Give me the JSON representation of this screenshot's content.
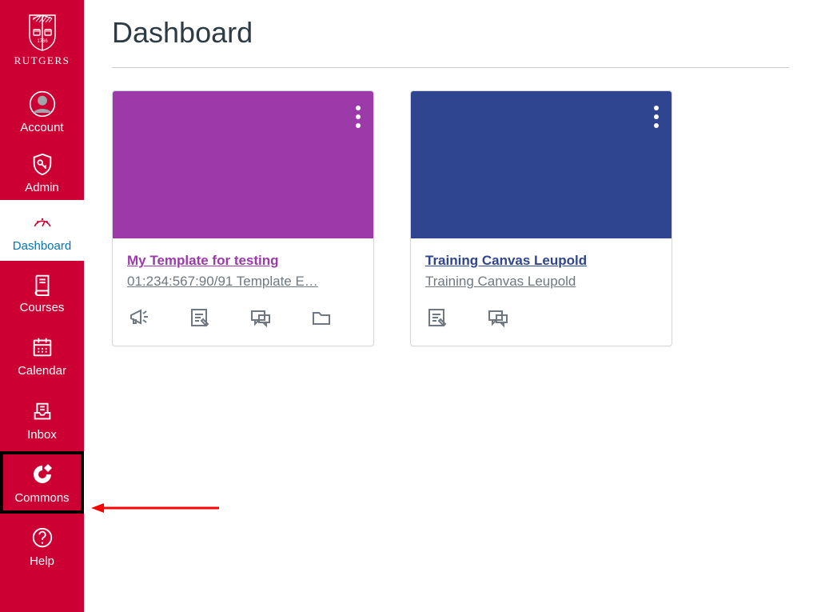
{
  "brand": {
    "name": "RUTGERS"
  },
  "nav": {
    "account": "Account",
    "admin": "Admin",
    "dashboard": "Dashboard",
    "courses": "Courses",
    "calendar": "Calendar",
    "inbox": "Inbox",
    "commons": "Commons",
    "help": "Help"
  },
  "page": {
    "title": "Dashboard"
  },
  "cards": [
    {
      "title": "My Template for testing",
      "subtitle": "01:234:567:90/91 Template E…",
      "color": "#9b3aa8",
      "actions": [
        "announcements",
        "assignments",
        "discussions",
        "files"
      ]
    },
    {
      "title": "Training Canvas Leupold",
      "subtitle": "Training Canvas Leupold",
      "color": "#2f458f",
      "actions": [
        "assignments",
        "discussions"
      ]
    }
  ],
  "annotation": {
    "highlighted_nav": "Commons"
  }
}
